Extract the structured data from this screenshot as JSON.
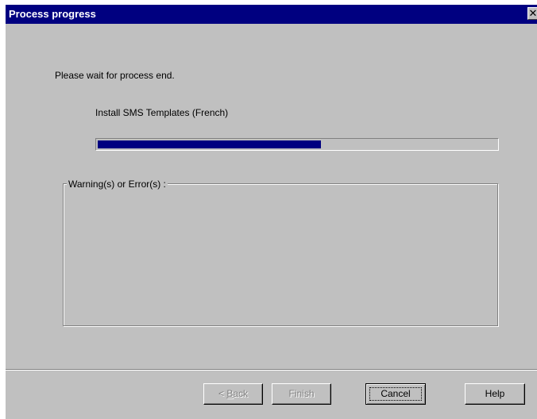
{
  "window": {
    "title": "Process progress",
    "close_glyph": "✕"
  },
  "content": {
    "message": "Please wait for process end.",
    "task": "Install SMS Templates (French)",
    "progress": 0.56,
    "group_label": "Warning(s) or Error(s) :",
    "group_text": ""
  },
  "buttons": {
    "back_prefix": "< ",
    "back_mnemonic": "B",
    "back_rest": "ack",
    "finish": "Finish",
    "cancel": "Cancel",
    "help": "Help"
  },
  "colors": {
    "titlebar": "#000080",
    "face": "#c0c0c0",
    "progress_fill": "#000080"
  },
  "icons": {
    "close": "close-icon"
  }
}
